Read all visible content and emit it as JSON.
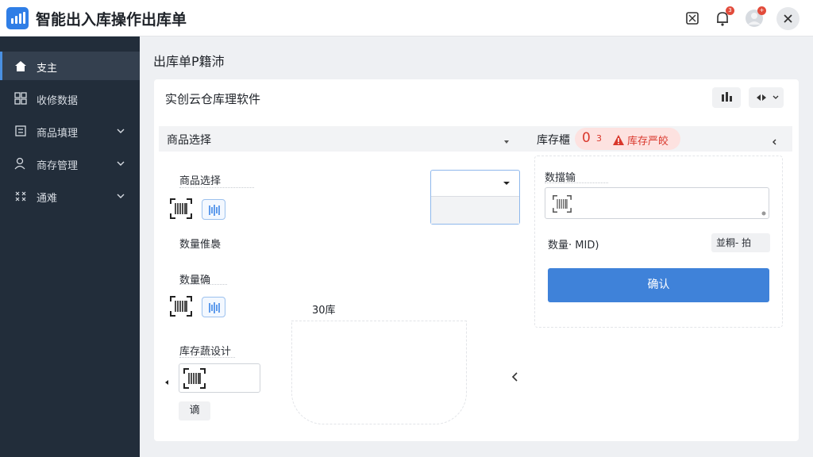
{
  "header": {
    "title": "智能出入库操作出库单",
    "notifications_badge": "3",
    "avatar_badge": "+"
  },
  "sidebar": {
    "items": [
      {
        "label": "支主"
      },
      {
        "label": "收修数据"
      },
      {
        "label": "商品填理"
      },
      {
        "label": "商存管理"
      },
      {
        "label": "通难"
      }
    ]
  },
  "page": {
    "title": "出库单P籍沛",
    "panel_title": "实创云仓库理软件"
  },
  "section": {
    "left_label": "商品选择",
    "right_label": "库存櫃",
    "stock_count": "0",
    "stock_sub": "3",
    "stock_warning": "库存严皎"
  },
  "form": {
    "product_select_label": "商品选择",
    "qty_info_label": "数量倠裊",
    "qty_confirm_label": "数量确",
    "stock_design_label": "库存蔬设计",
    "qty_note": "30库",
    "small_button": "谪",
    "data_input_label": "数擋输",
    "qty_mid_label": "数量· MID)",
    "option_button": "並粡- 拍",
    "confirm_button": "确认"
  },
  "colors": {
    "primary": "#3f82d9",
    "sidebar_bg": "#222d3a",
    "warning": "#d9372b"
  }
}
